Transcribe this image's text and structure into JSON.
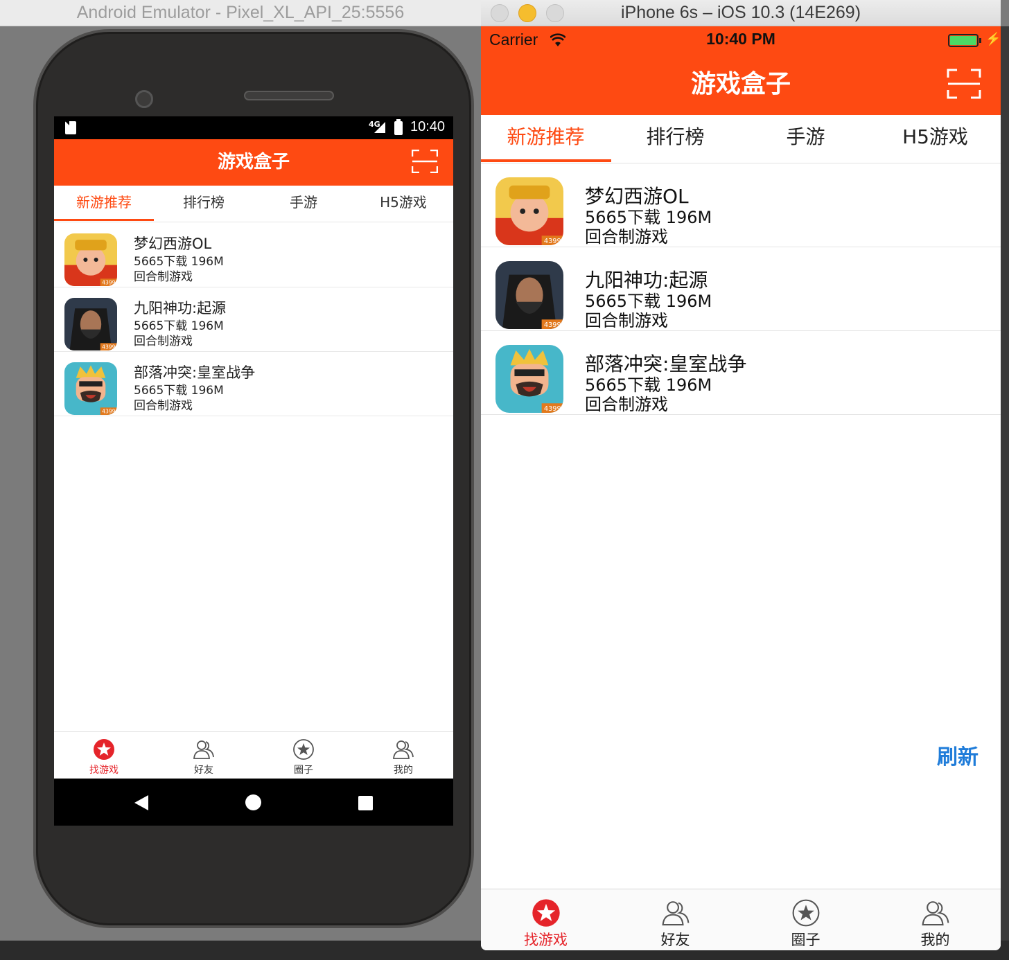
{
  "android": {
    "window_title": "Android Emulator - Pixel_XL_API_25:5556",
    "status": {
      "network": "4G",
      "time": "10:40"
    },
    "header": {
      "title": "游戏盒子",
      "scan_icon": "scan-icon"
    },
    "tabs": [
      {
        "label": "新游推荐",
        "active": true
      },
      {
        "label": "排行榜",
        "active": false
      },
      {
        "label": "手游",
        "active": false
      },
      {
        "label": "H5游戏",
        "active": false
      }
    ],
    "games": [
      {
        "name": "梦幻西游OL",
        "meta": "5665下载  196M",
        "category": "回合制游戏",
        "badge": "4399"
      },
      {
        "name": "九阳神功:起源",
        "meta": "5665下载  196M",
        "category": "回合制游戏",
        "badge": "4399"
      },
      {
        "name": "部落冲突:皇室战争",
        "meta": "5665下载  196M",
        "category": "回合制游戏",
        "badge": "4399"
      }
    ],
    "tabbar": [
      {
        "label": "找游戏",
        "icon": "star-circle-icon",
        "active": true
      },
      {
        "label": "好友",
        "icon": "friends-icon",
        "active": false
      },
      {
        "label": "圈子",
        "icon": "star-outline-icon",
        "active": false
      },
      {
        "label": "我的",
        "icon": "profile-icon",
        "active": false
      }
    ]
  },
  "ios": {
    "window_title": "iPhone 6s – iOS 10.3 (14E269)",
    "status": {
      "carrier": "Carrier",
      "time": "10:40 PM"
    },
    "header": {
      "title": "游戏盒子"
    },
    "tabs": [
      {
        "label": "新游推荐",
        "active": true
      },
      {
        "label": "排行榜",
        "active": false
      },
      {
        "label": "手游",
        "active": false
      },
      {
        "label": "H5游戏",
        "active": false
      }
    ],
    "games": [
      {
        "name": "梦幻西游OL",
        "meta": "5665下载  196M",
        "category": "回合制游戏",
        "badge": "4399"
      },
      {
        "name": "九阳神功:起源",
        "meta": "5665下载  196M",
        "category": "回合制游戏",
        "badge": "4399"
      },
      {
        "name": "部落冲突:皇室战争",
        "meta": "5665下载  196M",
        "category": "回合制游戏",
        "badge": "4399"
      }
    ],
    "refresh_label": "刷新",
    "tabbar": [
      {
        "label": "找游戏",
        "active": true
      },
      {
        "label": "好友",
        "active": false
      },
      {
        "label": "圈子",
        "active": false
      },
      {
        "label": "我的",
        "active": false
      }
    ]
  },
  "colors": {
    "accent": "#fe4a12",
    "tab_active_red": "#e5242a",
    "link_blue": "#1f7cd9"
  }
}
